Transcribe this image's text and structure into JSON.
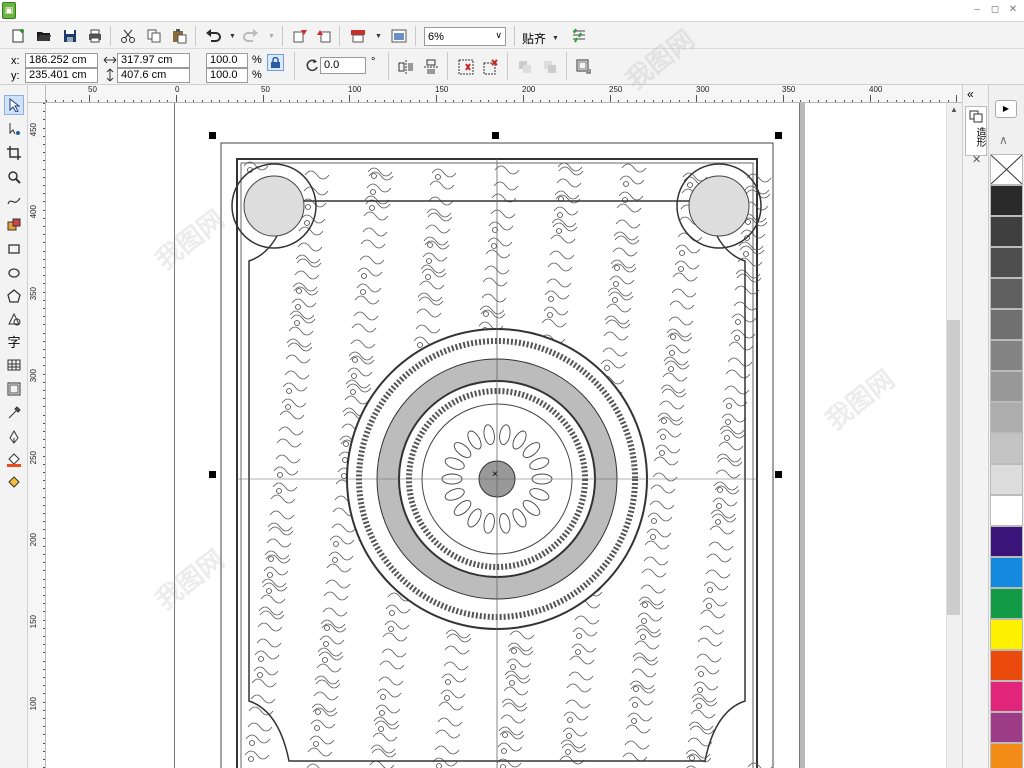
{
  "app": {
    "icon": "coreldraw-app-icon"
  },
  "window_controls": {
    "minimize": "–",
    "restore": "◻",
    "close": "✕"
  },
  "standard_toolbar": {
    "zoom_level": "6%",
    "snap_label": "贴齐",
    "icons": [
      "new-document-icon",
      "open-icon",
      "save-icon",
      "print-icon",
      "cut-icon",
      "copy-icon",
      "paste-icon",
      "undo-icon",
      "redo-icon",
      "import-icon",
      "export-icon",
      "publish-icon",
      "app-launcher-icon",
      "options-icon"
    ]
  },
  "property_bar": {
    "x_label": "x:",
    "x_value": "186.252 cm",
    "y_label": "y:",
    "y_value": "235.401 cm",
    "width_value": "317.97 cm",
    "height_value": "407.6 cm",
    "scale_x": "100.0",
    "scale_y": "100.0",
    "percent": "%",
    "rotation": "0.0",
    "degree": "°"
  },
  "rulers": {
    "horizontal_labels": [
      "50",
      "0",
      "50",
      "100",
      "150",
      "200",
      "250",
      "300",
      "350",
      "400"
    ],
    "vertical_labels": [
      "450",
      "400",
      "350",
      "300",
      "250",
      "200",
      "150",
      "100"
    ]
  },
  "toolbox": {
    "text_tool_glyph": "字"
  },
  "docker": {
    "tab_label": "造形",
    "collapse": "«",
    "close": "✕"
  },
  "palette": {
    "scroll_up": "▲",
    "colors": [
      "#2a2a2a",
      "#3f3f3f",
      "#4e4e4e",
      "#5f5f5f",
      "#707070",
      "#848484",
      "#989898",
      "#adadad",
      "#c4c4c4",
      "#dcdcdc",
      "#ffffff",
      "#3b1479",
      "#1489de",
      "#139a47",
      "#fff200",
      "#ea4a0c",
      "#e0257a",
      "#9c3b86",
      "#f28c16"
    ]
  },
  "watermark": {
    "text": "我图网"
  }
}
